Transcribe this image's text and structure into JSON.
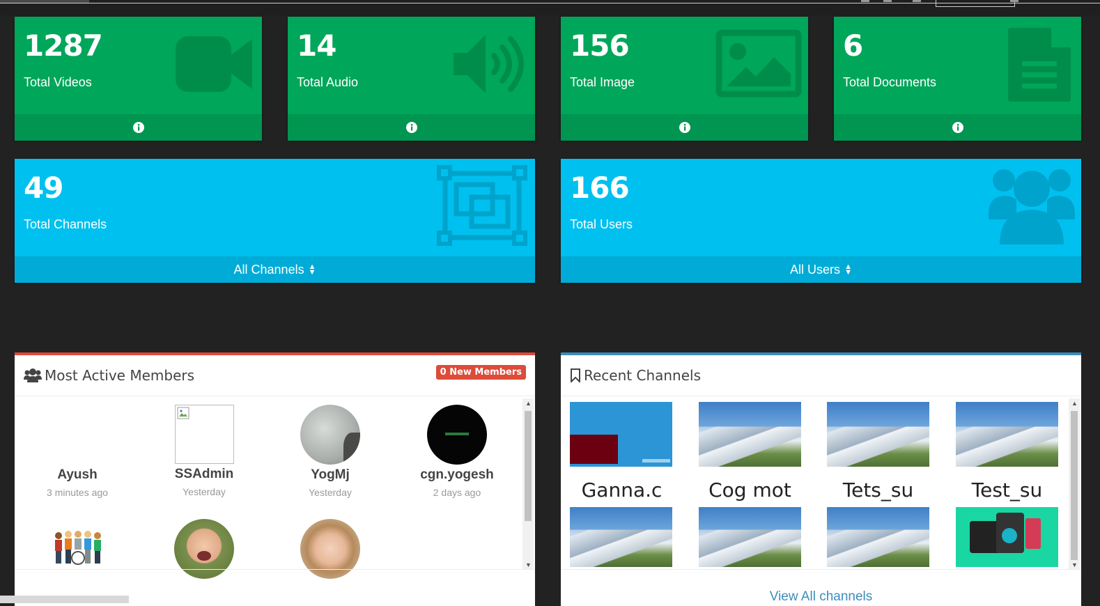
{
  "stats": {
    "videos": {
      "count": "1287",
      "label": "Total Videos",
      "icon": "video-camera-icon"
    },
    "audio": {
      "count": "14",
      "label": "Total Audio",
      "icon": "volume-up-icon"
    },
    "images": {
      "count": "156",
      "label": "Total Image",
      "icon": "image-icon"
    },
    "documents": {
      "count": "6",
      "label": "Total Documents",
      "icon": "file-text-icon"
    },
    "channels": {
      "count": "49",
      "label": "Total Channels",
      "footer": "All Channels",
      "icon": "object-group-icon"
    },
    "users": {
      "count": "166",
      "label": "Total Users",
      "footer": "All Users",
      "icon": "users-icon"
    }
  },
  "members_panel": {
    "title": "Most Active Members",
    "badge": "0 New Members",
    "members": [
      {
        "name": "Ayush",
        "time": "3 minutes ago"
      },
      {
        "name": "SSAdmin",
        "time": "Yesterday"
      },
      {
        "name": "YogMj",
        "time": "Yesterday"
      },
      {
        "name": "cgn.yogesh",
        "time": "2 days ago"
      }
    ]
  },
  "channels_panel": {
    "title": "Recent Channels",
    "channels": [
      {
        "name": "Ganna.c"
      },
      {
        "name": "Cog mot"
      },
      {
        "name": "Tets_su"
      },
      {
        "name": "Test_su"
      }
    ],
    "view_all": "View All channels"
  },
  "colors": {
    "green": "#00a65a",
    "aqua": "#00c0ef",
    "red": "#dd4b39",
    "link": "#3c8dbc",
    "background": "#222222"
  }
}
